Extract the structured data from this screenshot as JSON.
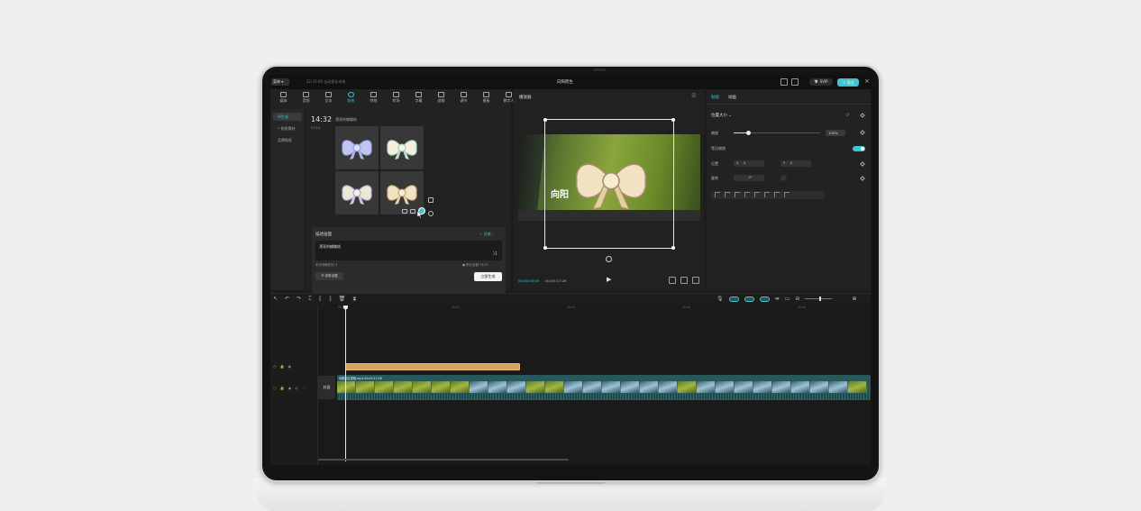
{
  "titlebar": {
    "menu_label": "菜单",
    "autosave": "22:33:00 自动保存本地",
    "doc_title": "向阳而生",
    "svip_label": "SVIP",
    "export_label": "导出"
  },
  "toolbar": {
    "tabs": [
      {
        "label": "媒体",
        "icon": "media-icon"
      },
      {
        "label": "音频",
        "icon": "audio-icon"
      },
      {
        "label": "文本",
        "icon": "text-icon"
      },
      {
        "label": "贴纸",
        "icon": "sticker-icon",
        "active": true
      },
      {
        "label": "特效",
        "icon": "effects-icon"
      },
      {
        "label": "转场",
        "icon": "transition-icon"
      },
      {
        "label": "字幕",
        "icon": "subtitle-icon"
      },
      {
        "label": "滤镜",
        "icon": "filter-icon"
      },
      {
        "label": "调节",
        "icon": "adjust-icon"
      },
      {
        "label": "模板",
        "icon": "template-icon"
      },
      {
        "label": "数字人",
        "icon": "avatar-icon"
      }
    ]
  },
  "side_nav": {
    "items": [
      {
        "label": "AI生成",
        "active": true
      },
      {
        "label": "• 贴纸素材",
        "active": false
      },
      {
        "label": "品牌贴纸",
        "active": false
      }
    ]
  },
  "generation": {
    "time": "14:32",
    "description": "漂亮的蝴蝶结",
    "date": "07/24"
  },
  "desc_panel": {
    "title": "描述画面",
    "more_label": "灵感",
    "text": "漂亮的蝴蝶结",
    "credits": "本次消耗积分 3",
    "points": "积分余额 3119",
    "ref_label": "参数设置",
    "generate_label": "立即生成"
  },
  "player": {
    "title": "播放器",
    "overlay_text": "向阳",
    "timecode_current": "00:00:00:05",
    "timecode_total": "00:00:17:26"
  },
  "right_panel": {
    "tab_sticker": "贴纸",
    "tab_animation": "动画",
    "section": "位置大小",
    "scale_label": "缩放",
    "scale_value": "100%",
    "scale_fraction": 0.17,
    "uniform_label": "等比缩放",
    "uniform_on": true,
    "position_label": "位置",
    "pos_x": "0",
    "pos_y": "0",
    "x_label": "X",
    "y_label": "Y",
    "rotate_label": "旋转",
    "rotate_value": "0°"
  },
  "timeline": {
    "ruler_labels": [
      "00:00",
      "00:02",
      "00:04",
      "00:06",
      "00:08"
    ],
    "video_clip_label": "向阳而生视频.mp4  00:00:17:26",
    "cover_label": "封面"
  },
  "colors": {
    "accent": "#3ec6d0",
    "sticker_clip": "#d5a659",
    "video_clip": "#29585b"
  }
}
